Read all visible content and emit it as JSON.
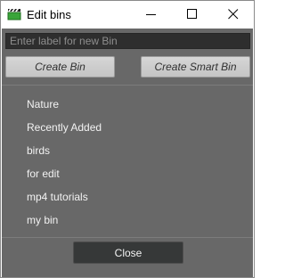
{
  "window": {
    "title": "Edit bins",
    "icon": "clapperboard-icon"
  },
  "form": {
    "label_placeholder": "Enter label for new Bin",
    "label_value": "",
    "create_bin_label": "Create Bin",
    "create_smart_bin_label": "Create Smart Bin"
  },
  "bins": [
    "Nature",
    "Recently Added",
    "birds",
    "for edit",
    "mp4 tutorials",
    "my bin"
  ],
  "footer": {
    "close_label": "Close"
  },
  "colors": {
    "panel_bg": "#686868",
    "input_bg": "#2e2e2e",
    "close_button_bg": "#363838",
    "icon_green": "#3aa53a"
  }
}
